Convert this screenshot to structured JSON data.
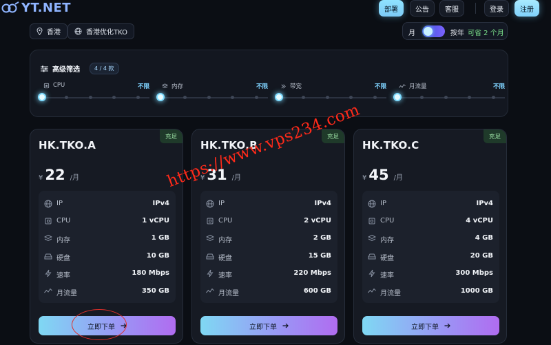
{
  "brand": {
    "logo_text": "YT.NET",
    "accent": "#8fe3ff"
  },
  "nav": {
    "deploy": "部署",
    "announce": "公告",
    "support": "客服",
    "login": "登录",
    "register": "注册"
  },
  "location": {
    "region": "香港",
    "node": "香港优化TKO"
  },
  "billing": {
    "monthly": "月",
    "yearly": "按年",
    "save_note": "可省 2 个月",
    "toggle_state": "monthly"
  },
  "filters": {
    "title": "高级筛选",
    "badge": "4 / 4 款",
    "sliders": [
      {
        "label": "CPU",
        "value": "不限",
        "icon": "chip-icon"
      },
      {
        "label": "内存",
        "value": "不限",
        "icon": "layers-icon"
      },
      {
        "label": "带宽",
        "value": "不限",
        "icon": "bandwidth-icon"
      },
      {
        "label": "月流量",
        "value": "不限",
        "icon": "traffic-icon"
      }
    ]
  },
  "plans": [
    {
      "name": "HK.TKO.A",
      "stock": "充足",
      "currency": "¥",
      "price": "22",
      "period": "/月",
      "specs": [
        {
          "k": "IP",
          "v": "IPv4",
          "icon": "globe-icon"
        },
        {
          "k": "CPU",
          "v": "1 vCPU",
          "icon": "chip-icon"
        },
        {
          "k": "内存",
          "v": "1 GB",
          "icon": "layers-icon"
        },
        {
          "k": "硬盘",
          "v": "10 GB",
          "icon": "disk-icon"
        },
        {
          "k": "速率",
          "v": "180 Mbps",
          "icon": "bolt-icon"
        },
        {
          "k": "月流量",
          "v": "350 GB",
          "icon": "traffic-icon"
        }
      ],
      "order": "立即下单"
    },
    {
      "name": "HK.TKO.B",
      "stock": "充足",
      "currency": "¥",
      "price": "31",
      "period": "/月",
      "specs": [
        {
          "k": "IP",
          "v": "IPv4",
          "icon": "globe-icon"
        },
        {
          "k": "CPU",
          "v": "2 vCPU",
          "icon": "chip-icon"
        },
        {
          "k": "内存",
          "v": "2 GB",
          "icon": "layers-icon"
        },
        {
          "k": "硬盘",
          "v": "15 GB",
          "icon": "disk-icon"
        },
        {
          "k": "速率",
          "v": "220 Mbps",
          "icon": "bolt-icon"
        },
        {
          "k": "月流量",
          "v": "600 GB",
          "icon": "traffic-icon"
        }
      ],
      "order": "立即下单"
    },
    {
      "name": "HK.TKO.C",
      "stock": "充足",
      "currency": "¥",
      "price": "45",
      "period": "/月",
      "specs": [
        {
          "k": "IP",
          "v": "IPv4",
          "icon": "globe-icon"
        },
        {
          "k": "CPU",
          "v": "4 vCPU",
          "icon": "chip-icon"
        },
        {
          "k": "内存",
          "v": "4 GB",
          "icon": "layers-icon"
        },
        {
          "k": "硬盘",
          "v": "20 GB",
          "icon": "disk-icon"
        },
        {
          "k": "速率",
          "v": "300 Mbps",
          "icon": "bolt-icon"
        },
        {
          "k": "月流量",
          "v": "1000 GB",
          "icon": "traffic-icon"
        }
      ],
      "order": "立即下单"
    }
  ],
  "watermark": "https://www.vps234.com"
}
